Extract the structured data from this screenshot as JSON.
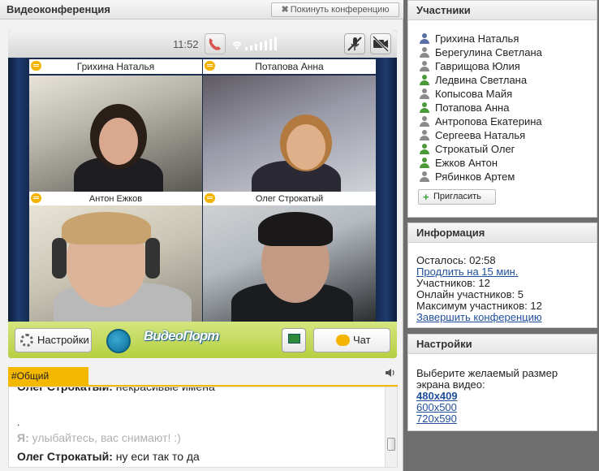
{
  "left": {
    "title": "Видеоконференция",
    "leave_label": "Покинуть конференцию"
  },
  "video": {
    "time": "11:52",
    "tiles": [
      {
        "name": "Грихина Наталья"
      },
      {
        "name": "Потапова Анна"
      },
      {
        "name": "Антон Ежков"
      },
      {
        "name": "Олег Строкатый"
      }
    ],
    "settings_label": "Настройки",
    "chat_label": "Чат",
    "logo_text": "ВидеоПорт"
  },
  "chat": {
    "tab_label": "#Общий",
    "lines": [
      {
        "nick": "Олег Строкатый:",
        "text": " некрасивые имена"
      },
      {
        "nick": "",
        "text": "."
      },
      {
        "nick": "Я:",
        "text": " улыбайтесь, вас снимают! :)"
      },
      {
        "nick": "Олег Строкатый:",
        "text": " ну еси так то да"
      }
    ]
  },
  "participants": {
    "title": "Участники",
    "items": [
      {
        "name": "Грихина Наталья",
        "color": "#5a6fa8"
      },
      {
        "name": "Берегулина Светлана",
        "color": "#8a8a8a"
      },
      {
        "name": "Гаврищова Юлия",
        "color": "#8a8a8a"
      },
      {
        "name": "Ледвина Светлана",
        "color": "#4a9a3a"
      },
      {
        "name": "Копысова Майя",
        "color": "#8a8a8a"
      },
      {
        "name": "Потапова Анна",
        "color": "#4a9a3a"
      },
      {
        "name": "Антропова Екатерина",
        "color": "#8a8a8a"
      },
      {
        "name": "Сергеева Наталья",
        "color": "#8a8a8a"
      },
      {
        "name": "Строкатый Олег",
        "color": "#4a9a3a"
      },
      {
        "name": "Ежков Антон",
        "color": "#4a9a3a"
      },
      {
        "name": "Рябинков Артем",
        "color": "#8a8a8a"
      }
    ],
    "invite_label": "Пригласить"
  },
  "info": {
    "title": "Информация",
    "remaining": "Осталось: 02:58",
    "extend_link": "Продлить на 15 мин.",
    "participants": "Участников: 12",
    "online": "Онлайн участников: 5",
    "max": "Максимум участников: 12",
    "end_link": "Завершить конференцию"
  },
  "settings": {
    "title": "Настройки",
    "prompt_line1": "Выберите желаемый размер",
    "prompt_line2": "экрана видео:",
    "sizes": [
      "480x409",
      "600x500",
      "720x590"
    ]
  }
}
